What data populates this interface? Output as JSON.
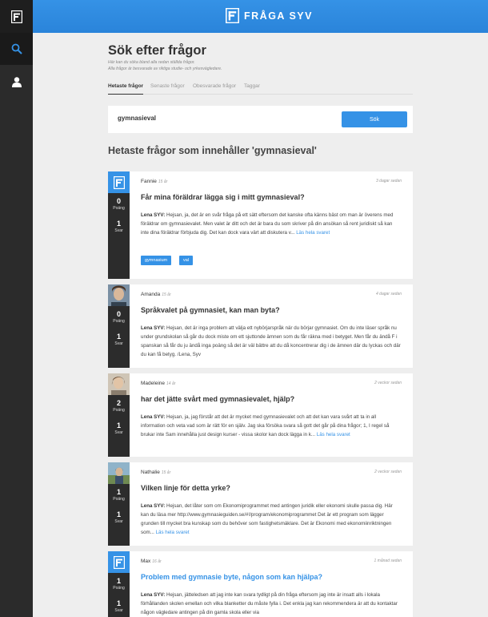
{
  "app": {
    "brand": "FRÅGA SYV",
    "colors": {
      "accent": "#3592e6",
      "sidebar": "#2b2b2b",
      "background": "#eeeeee"
    }
  },
  "sidebar": {
    "items": [
      {
        "icon": "logo-icon"
      },
      {
        "icon": "search-icon",
        "active": true
      },
      {
        "icon": "user-icon"
      }
    ]
  },
  "header": {
    "title": "Sök efter frågor",
    "subtitle_line1": "Här kan du söka bland alla redan ställda frågor.",
    "subtitle_line2": "Alla frågor är besvarade av riktiga studie- och yrkesvägledare."
  },
  "tabs": [
    "Hetaste frågor",
    "Senaste frågor",
    "Obesvarade frågor",
    "Taggar"
  ],
  "search": {
    "value": "gymnasieval",
    "button": "Sök"
  },
  "results_title": "Hetaste frågor som innehåller 'gymnasieval'",
  "labels": {
    "points": "Poäng",
    "answers": "Svar",
    "more": "Läs hela svaret",
    "answerer": "Lena SYV:"
  },
  "questions": [
    {
      "author": "Fannie",
      "age": "15 år",
      "time": "3 dagar sedan",
      "points": "0",
      "answers": "1",
      "title": "Får mina föräldrar lägga sig i mitt gymnasieval?",
      "answer": "Hejsan, ja, det är en svår fråga på ett sätt eftersom det kanske ofta känns bäst om man är överens med föräldrar om gymnasievalet. Men valet är ditt och det är bara du som skriver på din ansökan så rent juridiskt så kan inte dina föräldrar förbjuda dig. Det kan dock vara värt att diskutera v...",
      "tags": [
        "gymnasium",
        "val"
      ]
    },
    {
      "author": "Amanda",
      "age": "15 år",
      "time": "4 dagar sedan",
      "points": "0",
      "answers": "1",
      "title": "Språkvalet på gymnasiet, kan man byta?",
      "answer": "Hejsan, det är inga problem att välja ett nybörjarspråk när du börjar gymnasiet. Om du inte läser språk nu under grundskolan så går du dock miste om ett sjuttonde ämnen som du får räkna med i betyget. Men får du ändå F i spanskan så får du ju ändå inga poäng så det är väl bättre att du då koncentrerar dig i de ämnen där du lyckas och där du kan få betyg. /Lena, Syv"
    },
    {
      "author": "Madeleine",
      "age": "14 år",
      "time": "2 veckor sedan",
      "points": "2",
      "answers": "1",
      "title": "har det jätte svårt med gymnasievalet, hjälp?",
      "answer": "Hejsan, ja, jag förstår att det är mycket med gymnasievalet och att det kan vara svårt att ta in all information och veta vad som är rätt för en själv. Jag ska försöka svara så gott det går på dina frågor; 1, I regel så brukar inte Sam innehålla just design kurser - vissa skolor kan dock lägga in k..."
    },
    {
      "author": "Nathalie",
      "age": "15 år",
      "time": "2 veckor sedan",
      "points": "1",
      "answers": "1",
      "title": "Vilken linje för detta yrke?",
      "answer": "Hejsan, det låter som om Ekonomiprogrammet med antingen juridik eller ekonomi skulle passa dig. Här kan du läsa mer http://www.gymnasieguiden.se/#!/program/ekonomiprogrammet Det är ett program som lägger grunden till mycket bra kunskap som du behöver som fastighetsmäklare. Det är Ekonomi med ekonomiinriktningen som..."
    },
    {
      "author": "Max",
      "age": "16 år",
      "time": "1 månad sedan",
      "points": "1",
      "answers": "1",
      "title": "Problem med gymnasie byte, någon som kan hjälpa?",
      "answer": "Hejsan, jätteledsen att jag inte kan svara tydligt på din fråga eftersom jag inte är insatt alls i lokala förhållanden skolen emellan och vilka blanketter du måste fylla i. Det enkla jag kan rekommendera är att du kontaktar någon vägledare antingen på din gamla skola eller via"
    }
  ]
}
